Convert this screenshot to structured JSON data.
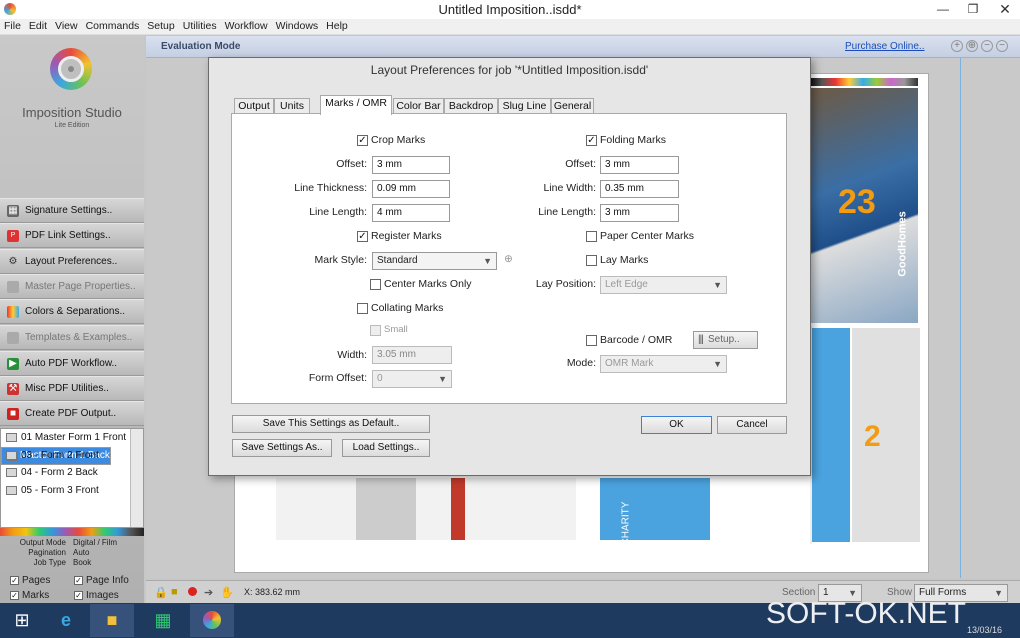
{
  "window": {
    "title": "Untitled Imposition..isdd*"
  },
  "menu": [
    "File",
    "Edit",
    "View",
    "Commands",
    "Setup",
    "Utilities",
    "Workflow",
    "Windows",
    "Help"
  ],
  "app": {
    "name": "Imposition Studio",
    "edition": "Lite Edition"
  },
  "nav": [
    "Signature Settings..",
    "PDF Link Settings..",
    "Layout Preferences..",
    "Master Page Properties..",
    "Colors & Separations..",
    "Templates & Examples..",
    "Auto PDF Workflow..",
    "Misc PDF Utilities..",
    "Create PDF Output.."
  ],
  "forms": [
    "01 Master Form 1 Front",
    "02 Master Form 1 Back",
    "03 - Form 2 Front",
    "04 - Form 2 Back",
    "05 - Form 3 Front"
  ],
  "info": [
    {
      "k": "Output Mode",
      "v": "Digital / Film"
    },
    {
      "k": "Pagination",
      "v": "Auto"
    },
    {
      "k": "Job Type",
      "v": "Book"
    }
  ],
  "bottom_checks": {
    "pages": "Pages",
    "marks": "Marks",
    "page_info": "Page Info",
    "images": "Images"
  },
  "evalbar": {
    "mode": "Evaluation Mode",
    "purchase": "Purchase Online.."
  },
  "status": {
    "coord": "X: 383.62 mm",
    "section_label": "Section",
    "section_value": "1",
    "show_label": "Show",
    "show_value": "Full Forms"
  },
  "taskbar": {
    "watermark": "SOFT-OK.NET",
    "date": "13/03/16"
  },
  "dialog": {
    "title": "Layout Preferences for job '*Untitled Imposition.isdd'",
    "tabs": [
      "Output",
      "Units",
      "Marks / OMR",
      "Color Bar",
      "Backdrop",
      "Slug Line",
      "General"
    ],
    "left": {
      "crop_marks": "Crop Marks",
      "offset_label": "Offset:",
      "offset": "3 mm",
      "thickness_label": "Line Thickness:",
      "thickness": "0.09 mm",
      "length_label": "Line Length:",
      "length": "4 mm",
      "register_marks": "Register Marks",
      "mark_style_label": "Mark Style:",
      "mark_style": "Standard",
      "center_only": "Center Marks Only",
      "collating": "Collating Marks",
      "small": "Small",
      "width_label": "Width:",
      "width": "3.05 mm",
      "form_offset_label": "Form Offset:",
      "form_offset": "0"
    },
    "right": {
      "folding_marks": "Folding Marks",
      "offset_label": "Offset:",
      "offset": "3 mm",
      "width_label": "Line Width:",
      "width": "0.35 mm",
      "length_label": "Line Length:",
      "length": "3 mm",
      "paper_center": "Paper Center Marks",
      "lay_marks": "Lay Marks",
      "lay_pos_label": "Lay Position:",
      "lay_pos": "Left Edge",
      "barcode": "Barcode / OMR",
      "setup": "Setup..",
      "mode_label": "Mode:",
      "mode": "OMR Mark"
    },
    "buttons": {
      "save_default": "Save This Settings as Default..",
      "save_as": "Save Settings As..",
      "load": "Load Settings..",
      "ok": "OK",
      "cancel": "Cancel"
    }
  },
  "preview": {
    "num1": "23",
    "num2": "2",
    "brand": "GoodHomes",
    "charity": "CHARITY"
  }
}
